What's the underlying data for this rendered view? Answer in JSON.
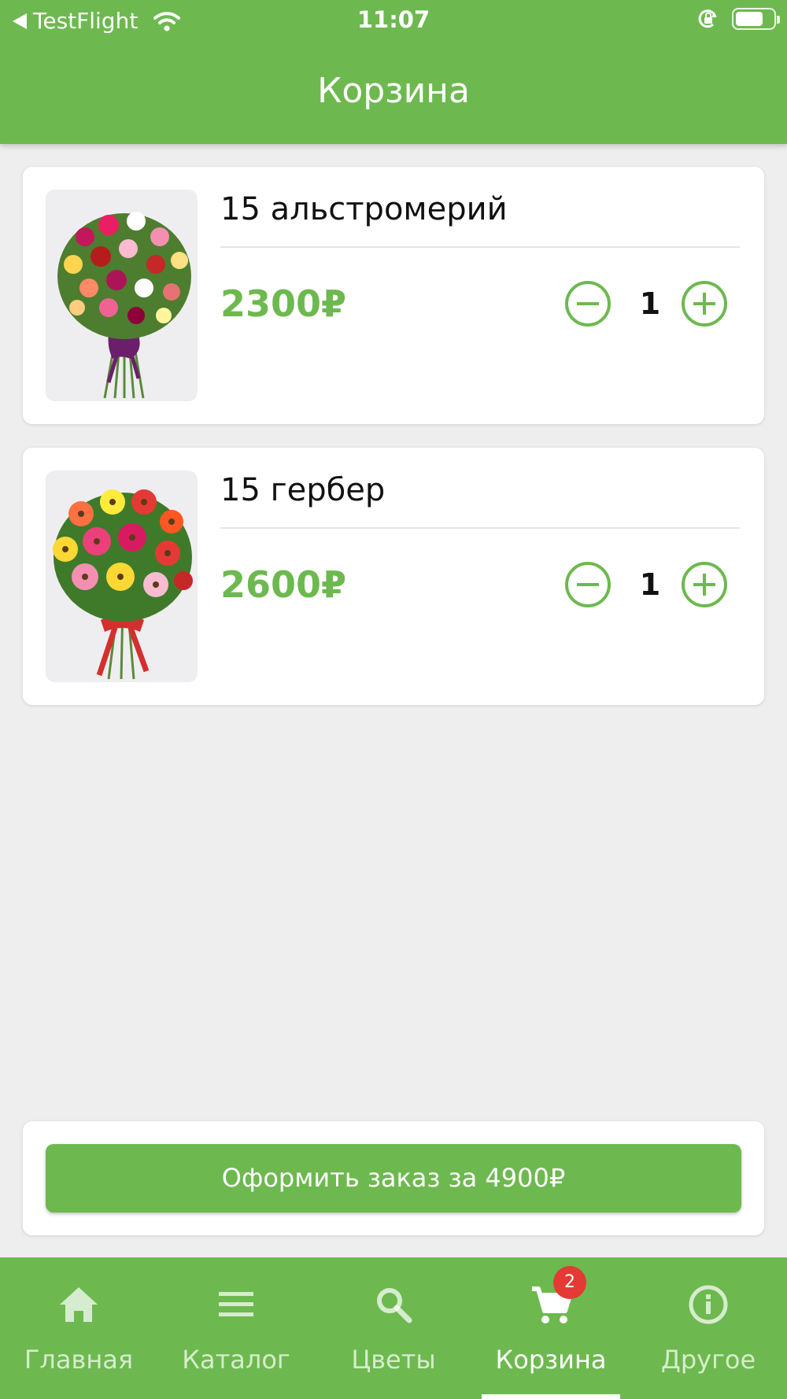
{
  "status_bar": {
    "back_app": "TestFlight",
    "time": "11:07"
  },
  "header": {
    "title": "Корзина"
  },
  "cart": {
    "items": [
      {
        "name": "15 альстромерий",
        "price": "2300₽",
        "quantity": "1",
        "image": "alstroemeria-bouquet"
      },
      {
        "name": "15 гербер",
        "price": "2600₽",
        "quantity": "1",
        "image": "gerbera-bouquet"
      }
    ]
  },
  "order": {
    "button_label": "Оформить заказ за 4900₽"
  },
  "tabbar": {
    "tabs": [
      {
        "label": "Главная",
        "icon": "home-icon"
      },
      {
        "label": "Каталог",
        "icon": "menu-icon"
      },
      {
        "label": "Цветы",
        "icon": "search-icon"
      },
      {
        "label": "Корзина",
        "icon": "cart-icon",
        "badge": "2",
        "active": true
      },
      {
        "label": "Другое",
        "icon": "info-icon"
      }
    ]
  },
  "colors": {
    "brand_green": "#6db94f",
    "badge_red": "#e53935",
    "background": "#eeeeee"
  }
}
